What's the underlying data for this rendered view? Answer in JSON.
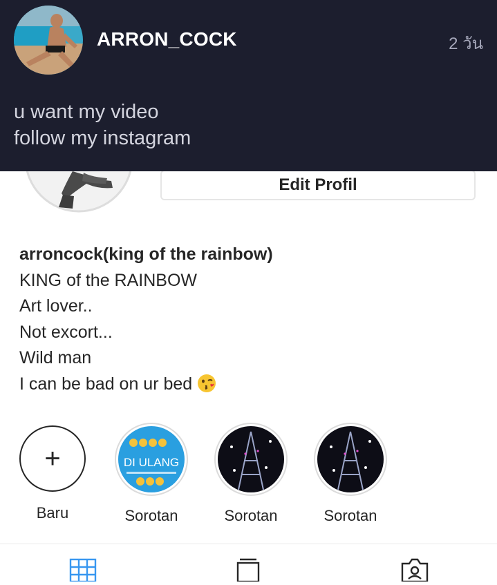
{
  "notification": {
    "username": "ARRON_COCK",
    "time": "2 วัน",
    "message_lines": [
      "u want my video",
      "follow my instagram"
    ]
  },
  "profile": {
    "edit_button": "Edit Profil",
    "bio": {
      "name": "arroncock(king of the rainbow)",
      "lines": [
        "KING of the RAINBOW",
        "Art lover..",
        "Not excort...",
        "Wild man",
        "I can be bad on ur bed"
      ]
    }
  },
  "highlights": [
    {
      "label": "Baru",
      "type": "new",
      "icon": "plus-icon"
    },
    {
      "label": "Sorotan",
      "type": "cover",
      "cover_text": "DI ULANG"
    },
    {
      "label": "Sorotan",
      "type": "cover"
    },
    {
      "label": "Sorotan",
      "type": "cover"
    }
  ],
  "tabs": [
    {
      "icon": "grid-icon",
      "active": true
    },
    {
      "icon": "tv-icon",
      "active": false
    },
    {
      "icon": "tagged-icon",
      "active": false
    }
  ],
  "colors": {
    "overlay_bg": "#1c1e2e",
    "active_tab": "#3897f0",
    "text_primary": "#262626"
  }
}
